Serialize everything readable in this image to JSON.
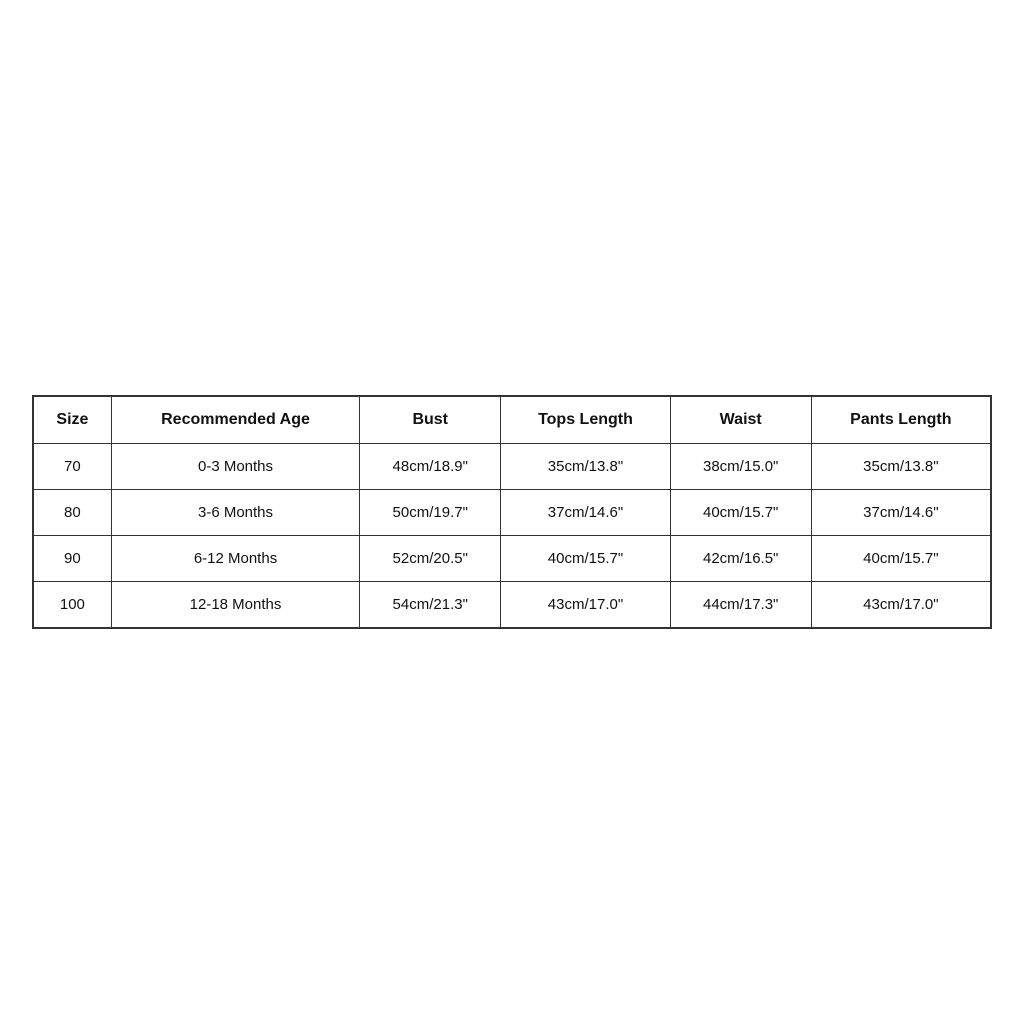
{
  "table": {
    "columns": [
      {
        "id": "size",
        "label": "Size"
      },
      {
        "id": "recommended_age",
        "label": "Recommended Age"
      },
      {
        "id": "bust",
        "label": "Bust"
      },
      {
        "id": "tops_length",
        "label": "Tops Length"
      },
      {
        "id": "waist",
        "label": "Waist"
      },
      {
        "id": "pants_length",
        "label": "Pants Length"
      }
    ],
    "rows": [
      {
        "size": "70",
        "recommended_age": "0-3 Months",
        "bust": "48cm/18.9\"",
        "tops_length": "35cm/13.8\"",
        "waist": "38cm/15.0\"",
        "pants_length": "35cm/13.8\""
      },
      {
        "size": "80",
        "recommended_age": "3-6 Months",
        "bust": "50cm/19.7\"",
        "tops_length": "37cm/14.6\"",
        "waist": "40cm/15.7\"",
        "pants_length": "37cm/14.6\""
      },
      {
        "size": "90",
        "recommended_age": "6-12 Months",
        "bust": "52cm/20.5\"",
        "tops_length": "40cm/15.7\"",
        "waist": "42cm/16.5\"",
        "pants_length": "40cm/15.7\""
      },
      {
        "size": "100",
        "recommended_age": "12-18 Months",
        "bust": "54cm/21.3\"",
        "tops_length": "43cm/17.0\"",
        "waist": "44cm/17.3\"",
        "pants_length": "43cm/17.0\""
      }
    ]
  }
}
